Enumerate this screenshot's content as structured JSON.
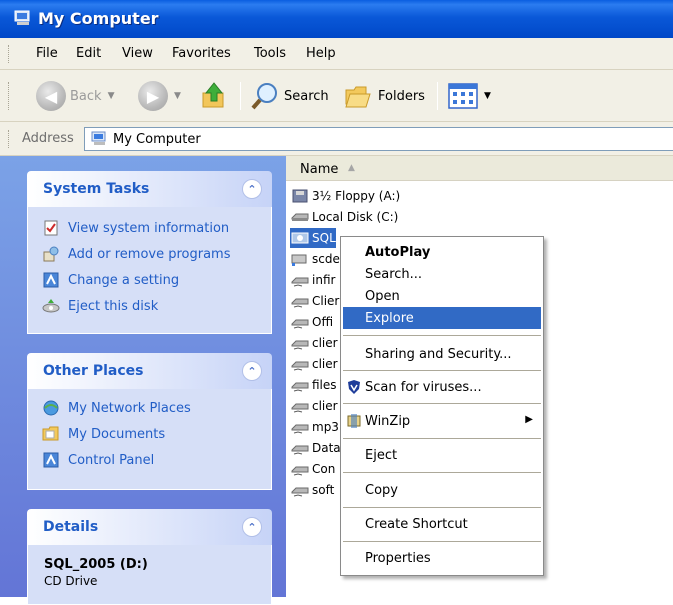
{
  "window": {
    "title": "My Computer"
  },
  "menu": [
    "File",
    "Edit",
    "View",
    "Favorites",
    "Tools",
    "Help"
  ],
  "toolbar": {
    "back": "Back",
    "search": "Search",
    "folders": "Folders"
  },
  "address": {
    "label": "Address",
    "value": "My Computer"
  },
  "system_tasks": {
    "title": "System Tasks",
    "items": [
      "View system information",
      "Add or remove programs",
      "Change a setting",
      "Eject this disk"
    ]
  },
  "other_places": {
    "title": "Other Places",
    "items": [
      "My Network Places",
      "My Documents",
      "Control Panel"
    ]
  },
  "details": {
    "title": "Details",
    "name": "SQL_2005 (D:)",
    "type": "CD Drive"
  },
  "list": {
    "column": "Name",
    "items": [
      "3½ Floppy (A:)",
      "Local Disk (C:)",
      "SQL",
      "scde",
      "infir",
      "Clier",
      "Offi",
      "clier",
      "clier",
      "files",
      "clier",
      "mp3",
      "Data",
      "Con",
      "soft"
    ]
  },
  "context_menu": {
    "items": [
      "AutoPlay",
      "Search...",
      "Open",
      "Explore",
      "Sharing and Security...",
      "Scan for viruses...",
      "WinZip",
      "Eject",
      "Copy",
      "Create Shortcut",
      "Properties"
    ]
  },
  "colors": {
    "titlebar": "#0a58d8",
    "panel": "#6375d6",
    "highlight": "#316ac5",
    "task_text": "#215dc6"
  }
}
